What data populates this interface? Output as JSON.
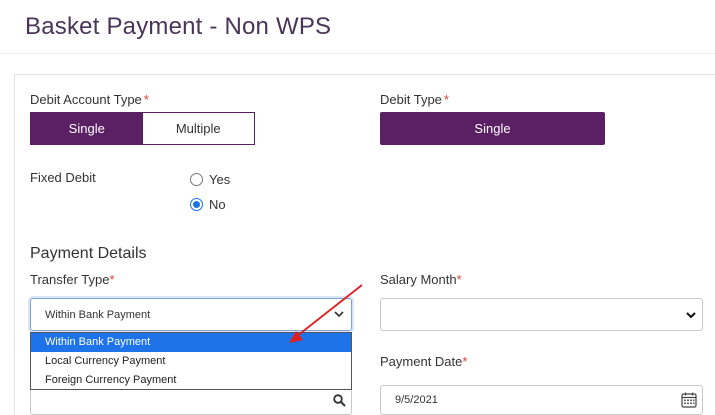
{
  "header": {
    "title": "Basket Payment - Non WPS"
  },
  "debit_account_type": {
    "label": "Debit Account Type",
    "required_mark": "*",
    "options": [
      "Single",
      "Multiple"
    ],
    "selected": "Single"
  },
  "debit_type": {
    "label": "Debit Type",
    "required_mark": "*",
    "button_label": "Single"
  },
  "fixed_debit": {
    "label": "Fixed Debit",
    "options": [
      "Yes",
      "No"
    ],
    "selected": "No"
  },
  "payment_details": {
    "section_title": "Payment Details",
    "transfer_type": {
      "label": "Transfer Type",
      "required_mark": "*",
      "value": "Within Bank Payment",
      "options": [
        "Within Bank Payment",
        "Local Currency Payment",
        "Foreign Currency Payment"
      ],
      "highlighted": "Within Bank Payment"
    },
    "salary_month": {
      "label": "Salary Month",
      "required_mark": "*",
      "value": ""
    },
    "payment_date": {
      "label": "Payment Date",
      "required_mark": "*",
      "value": "9/5/2021"
    }
  },
  "colors": {
    "primary_purple": "#5b1f63",
    "title_color": "#4a3558",
    "highlight_blue": "#1e73e8",
    "annotation_arrow": "#e02020"
  }
}
